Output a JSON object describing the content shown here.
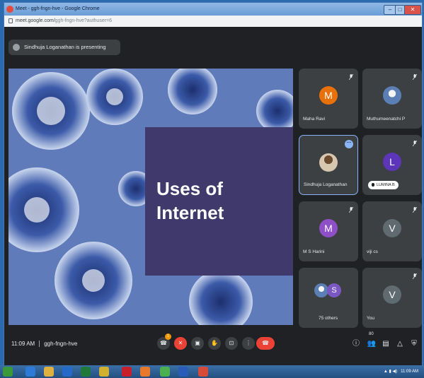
{
  "browser": {
    "window_title": "Meet - ggh-fngn-hve - Google Chrome",
    "url_host": "meet.google.com/",
    "url_path": "ggh-fngn-hve?authuser=6",
    "minimize_label": "–",
    "maximize_label": "□",
    "close_label": "✕"
  },
  "presenting_banner": "Sindhuja Loganathan is presenting",
  "slide": {
    "title_line1": "Uses of",
    "title_line2": "Internet"
  },
  "participants": [
    {
      "name": "Maha Ravi",
      "initial": "M",
      "color": "#e8710a",
      "icon": "mic-off-icon"
    },
    {
      "name": "Muthumeenatchi P",
      "initial": "",
      "color": "#5b7fb5",
      "icon": "mic-off-icon"
    },
    {
      "name": "Sindhuja Loganathan",
      "initial": "",
      "color": "#c9b8a0",
      "icon": "more-options-icon"
    },
    {
      "name": "LUMINA B",
      "initial": "L",
      "color": "#5c35b8",
      "icon": "mic-off-icon"
    },
    {
      "name": "M S Harini",
      "initial": "M",
      "color": "#8e4fc7",
      "icon": "mic-off-icon"
    },
    {
      "name": "viji cs",
      "initial": "V",
      "color": "#5f6b70",
      "icon": "mic-off-icon"
    },
    {
      "name": "75 others",
      "initial": "S",
      "color": "#7b57c4",
      "icon": ""
    },
    {
      "name": "You",
      "initial": "V",
      "color": "#5f6b70",
      "icon": "mic-off-icon"
    }
  ],
  "bottom_bar": {
    "time": "11:09 AM",
    "meeting_code": "ggh-fngn-hve",
    "participant_count": "80"
  },
  "controls": [
    "raise-hand-icon",
    "mic-off-icon",
    "camera-off-icon",
    "captions-icon",
    "hand-icon",
    "present-icon",
    "more-icon",
    "end-call-icon"
  ],
  "taskbar": {
    "tray_time": "11:09 AM"
  }
}
